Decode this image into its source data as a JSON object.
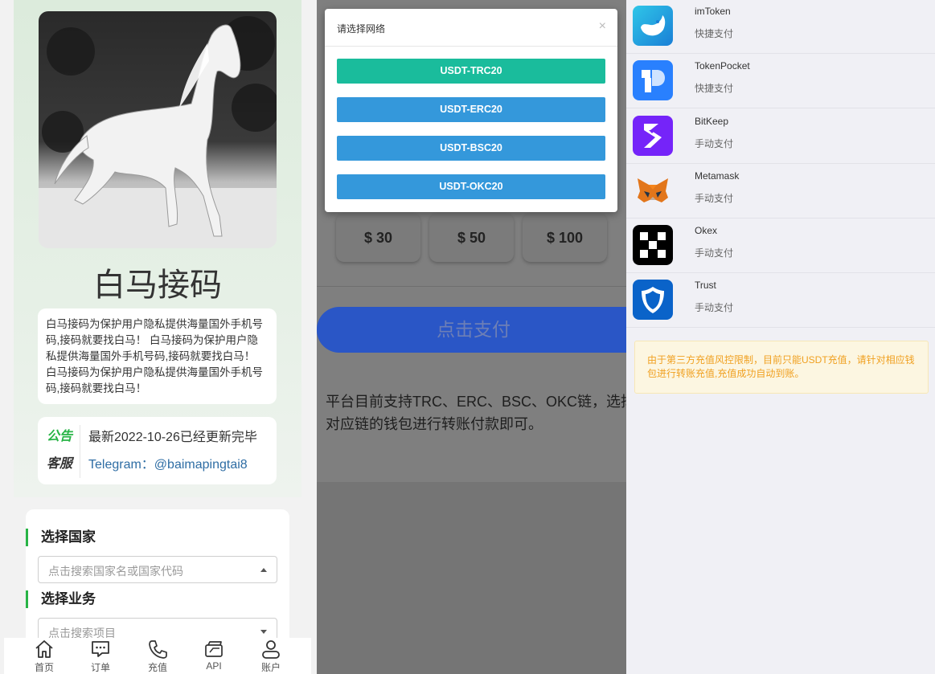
{
  "site": {
    "title": "白马接码",
    "intro": "白马接码为保护用户隐私提供海量国外手机号码,接码就要找白马！ 白马接码为保护用户隐私提供海量国外手机号码,接码就要找白马！ 白马接码为保护用户隐私提供海量国外手机号码,接码就要找白马！"
  },
  "notice": {
    "announcement_label": "公告",
    "announcement_text": "最新2022-10-26已经更新完毕",
    "support_label": "客服",
    "support_text": "Telegram：@baimapingtai8"
  },
  "selection": {
    "country_title": "选择国家",
    "country_placeholder": "点击搜索国家名或国家代码",
    "service_title": "选择业务",
    "service_placeholder": "点击搜索项目"
  },
  "nav": [
    {
      "label": "首页",
      "icon": "home-icon"
    },
    {
      "label": "订单",
      "icon": "chat-icon"
    },
    {
      "label": "充值",
      "icon": "phone-icon"
    },
    {
      "label": "API",
      "icon": "cards-icon"
    },
    {
      "label": "账户",
      "icon": "user-icon"
    }
  ],
  "recharge": {
    "amounts": [
      "$ 30",
      "$ 50",
      "$ 100"
    ],
    "pay_button": "点击支付",
    "description": "平台目前支持TRC、ERC、BSC、OKC链，选择对应链的钱包进行转账付款即可。"
  },
  "modal": {
    "title": "请选择网络",
    "close": "×",
    "networks": [
      {
        "label": "USDT-TRC20",
        "color": "#1abc9c"
      },
      {
        "label": "USDT-ERC20",
        "color": "#3498db"
      },
      {
        "label": "USDT-BSC20",
        "color": "#3498db"
      },
      {
        "label": "USDT-OKC20",
        "color": "#3498db"
      }
    ]
  },
  "wallets": [
    {
      "name": "imToken",
      "mode": "快捷支付",
      "icon": "imtoken-logo"
    },
    {
      "name": "TokenPocket",
      "mode": "快捷支付",
      "icon": "tokenpocket-logo"
    },
    {
      "name": "BitKeep",
      "mode": "手动支付",
      "icon": "bitkeep-logo"
    },
    {
      "name": "Metamask",
      "mode": "手动支付",
      "icon": "metamask-fox-logo"
    },
    {
      "name": "Okex",
      "mode": "手动支付",
      "icon": "okex-logo"
    },
    {
      "name": "Trust",
      "mode": "手动支付",
      "icon": "trust-shield-logo"
    }
  ],
  "warning": "由于第三方充值风控限制，目前只能USDT充值，请针对相应钱包进行转账充值,充值成功自动到账。",
  "colors": {
    "accent_green": "#28b446",
    "link_blue": "#2e6da4",
    "pay_blue": "#2a56c6",
    "warn_text": "#f0a020"
  }
}
